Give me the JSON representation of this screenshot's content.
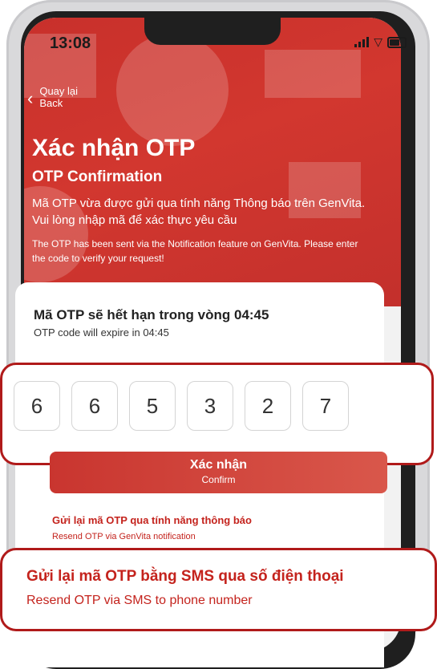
{
  "status_bar": {
    "time": "13:08"
  },
  "nav": {
    "back_vn": "Quay lại",
    "back_en": "Back"
  },
  "header": {
    "title": "Xác nhận OTP",
    "subtitle": "OTP Confirmation",
    "desc_vn": "Mã OTP vừa được gửi qua tính năng Thông báo trên GenVita. Vui lòng nhập mã để xác thực yêu cầu",
    "desc_en": "The OTP has been sent via the Notification feature on GenVita. Please enter the code to verify your request!"
  },
  "expiry": {
    "vn": "Mã OTP sẽ hết hạn trong vòng 04:45",
    "en": "OTP code will expire in 04:45"
  },
  "otp": {
    "digits": [
      "6",
      "6",
      "5",
      "3",
      "2",
      "7"
    ]
  },
  "confirm": {
    "vn": "Xác nhận",
    "en": "Confirm"
  },
  "resend_notification": {
    "vn": "Gửi lại mã OTP qua tính năng thông báo",
    "en": "Resend OTP via GenVita notification"
  },
  "resend_sms": {
    "vn": "Gửi lại mã OTP bằng SMS qua số điện thoại",
    "en": "Resend OTP via SMS to phone number"
  },
  "colors": {
    "brand_red": "#c8302b",
    "highlight": "#b01a1a",
    "link_red": "#c4231d"
  }
}
